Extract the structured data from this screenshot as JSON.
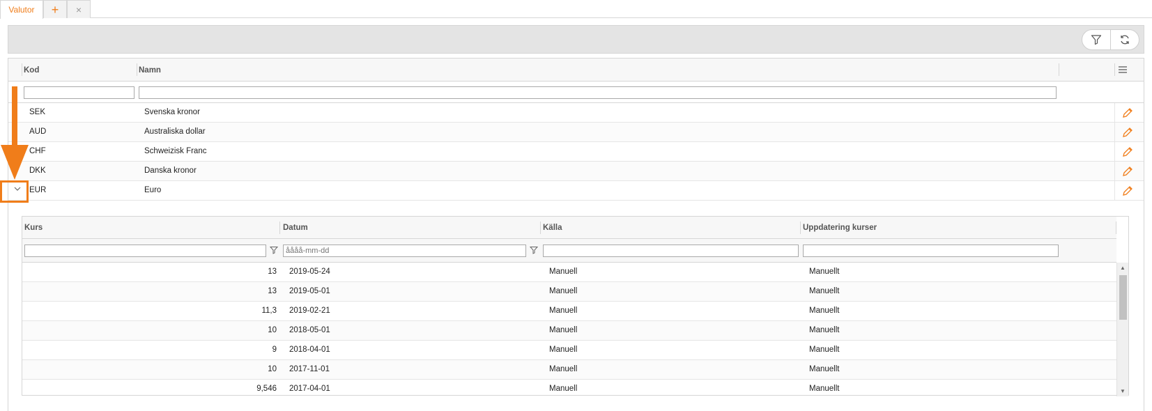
{
  "tabs": [
    {
      "label": "Valutor"
    }
  ],
  "tab_add_icon": "+",
  "tab_close_icon": "×",
  "colors": {
    "accent": "#f07d1a",
    "toolbar_bg": "#e4e4e4"
  },
  "toolbar": {
    "icons": [
      "filter-icon",
      "refresh-icon"
    ]
  },
  "grid": {
    "columns": [
      "Kod",
      "Namn"
    ],
    "rows": [
      {
        "kod": "SEK",
        "namn": "Svenska kronor"
      },
      {
        "kod": "AUD",
        "namn": "Australiska dollar"
      },
      {
        "kod": "CHF",
        "namn": "Schweizisk Franc"
      },
      {
        "kod": "DKK",
        "namn": "Danska kronor"
      },
      {
        "kod": "EUR",
        "namn": "Euro",
        "expanded": true
      }
    ]
  },
  "subgrid": {
    "columns": [
      "Kurs",
      "Datum",
      "Källa",
      "Uppdatering kurser"
    ],
    "date_placeholder": "åååå-mm-dd",
    "rows": [
      {
        "kurs": "13",
        "datum": "2019-05-24",
        "kalla": "Manuell",
        "uppdatering": "Manuellt"
      },
      {
        "kurs": "13",
        "datum": "2019-05-01",
        "kalla": "Manuell",
        "uppdatering": "Manuellt"
      },
      {
        "kurs": "11,3",
        "datum": "2019-02-21",
        "kalla": "Manuell",
        "uppdatering": "Manuellt"
      },
      {
        "kurs": "10",
        "datum": "2018-05-01",
        "kalla": "Manuell",
        "uppdatering": "Manuellt"
      },
      {
        "kurs": "9",
        "datum": "2018-04-01",
        "kalla": "Manuell",
        "uppdatering": "Manuellt"
      },
      {
        "kurs": "10",
        "datum": "2017-11-01",
        "kalla": "Manuell",
        "uppdatering": "Manuellt"
      },
      {
        "kurs": "9,546",
        "datum": "2017-04-01",
        "kalla": "Manuell",
        "uppdatering": "Manuellt"
      }
    ]
  }
}
